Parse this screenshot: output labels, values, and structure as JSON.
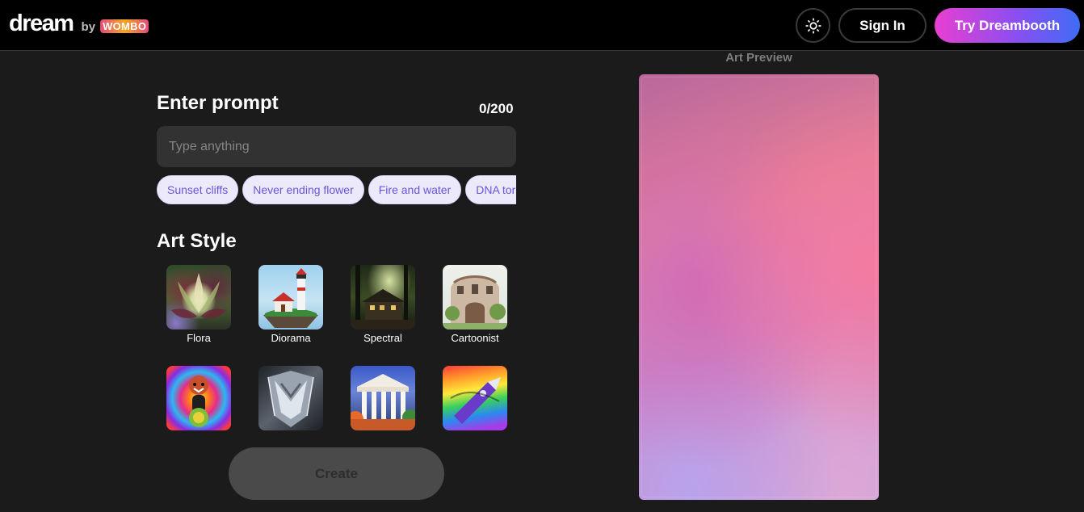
{
  "header": {
    "logo_word": "dream",
    "logo_by": "by",
    "logo_brand": "WOMBO",
    "theme_icon": "sun-icon",
    "signin_label": "Sign In",
    "dreambooth_label": "Try Dreambooth"
  },
  "prompt": {
    "title": "Enter prompt",
    "char_count": "0/200",
    "placeholder": "Type anything",
    "value": "",
    "suggestions": [
      "Sunset cliffs",
      "Never ending flower",
      "Fire and water",
      "DNA tornado"
    ]
  },
  "art_style": {
    "title": "Art Style",
    "styles": [
      {
        "label": "Flora",
        "selected": false
      },
      {
        "label": "Diorama",
        "selected": false
      },
      {
        "label": "Spectral",
        "selected": false
      },
      {
        "label": "Cartoonist",
        "selected": false
      },
      {
        "label": "",
        "selected": false
      },
      {
        "label": "",
        "selected": false
      },
      {
        "label": "",
        "selected": false
      },
      {
        "label": "",
        "selected": false
      }
    ]
  },
  "create_label": "Create",
  "preview": {
    "label": "Art Preview"
  },
  "colors": {
    "background": "#1b1b1b",
    "chip_bg": "#ece9fb",
    "chip_text": "#6a55d8",
    "dreambooth_gradient": [
      "#e83fd0",
      "#8d4ef0",
      "#3f6cf6"
    ]
  }
}
